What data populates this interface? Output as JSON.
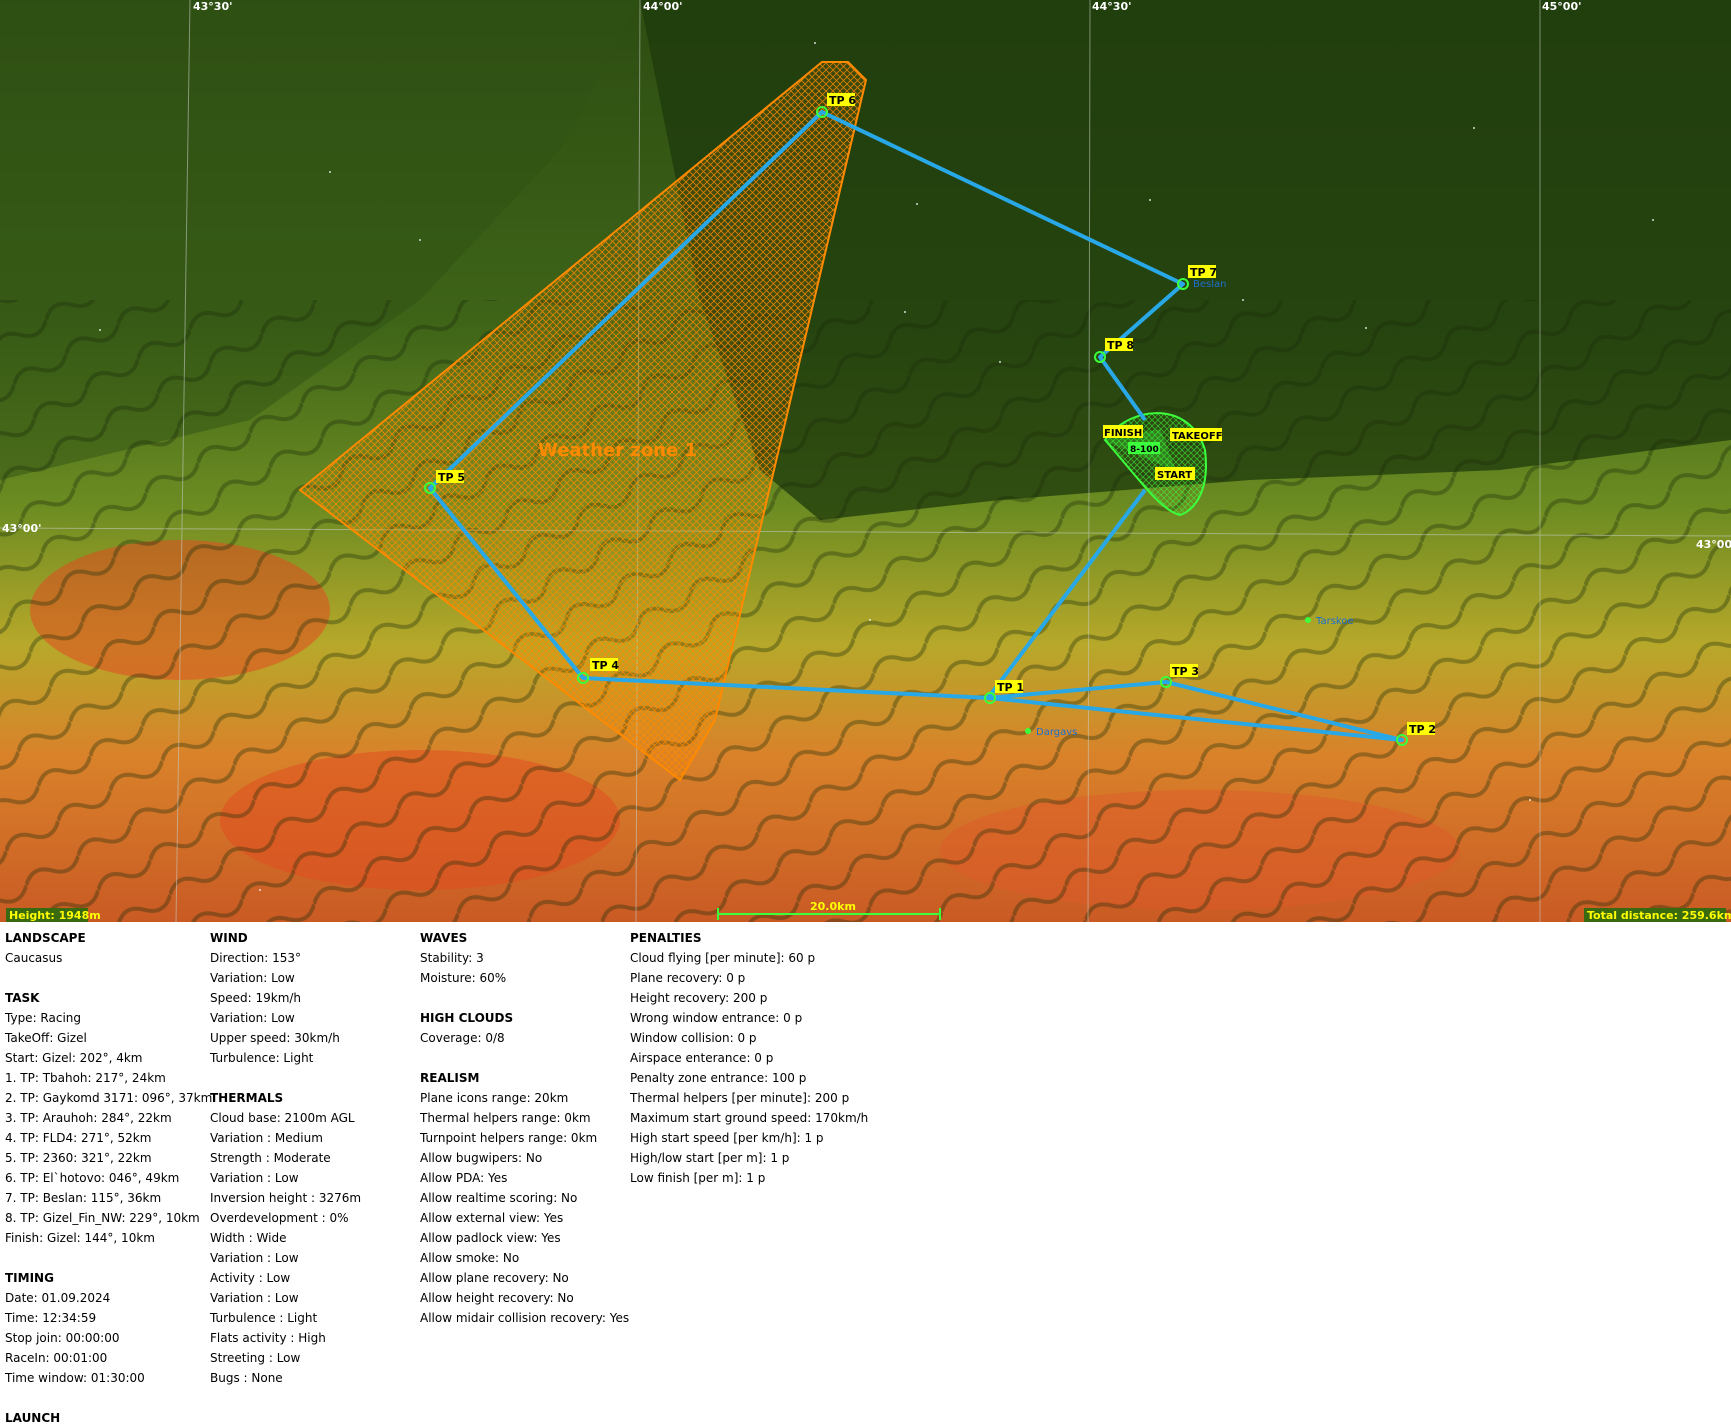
{
  "map": {
    "grid_labels": {
      "top": [
        "43°30'",
        "44°00'",
        "44°30'",
        "45°00'"
      ],
      "left": "43°00'",
      "right": "43°00'"
    },
    "zone_label": "Weather zone 1",
    "turnpoints": [
      "TP 1",
      "TP 2",
      "TP 3",
      "TP 4",
      "TP 5",
      "TP 6",
      "TP 7",
      "TP 8"
    ],
    "start_label": "START",
    "finish_label": "FINISH",
    "takeoff_label": "TAKEOFF",
    "height_label": "8-100",
    "towns": [
      "Beslan",
      "Tarskoe",
      "Dargavs"
    ],
    "height_readout": "Height: 1948m",
    "scale_label": "20.0km",
    "total_distance": "Total distance: 259.6km",
    "colors": {
      "route": "#29a8e8",
      "zone": "#ff8a00",
      "start_area": "#3cff3c",
      "label_bg": "#ffff00"
    }
  },
  "landscape": {
    "title": "LANDSCAPE",
    "value": "Caucasus"
  },
  "task": {
    "title": "TASK",
    "lines": [
      "Type: Racing",
      "TakeOff: Gizel",
      "Start: Gizel: 202°, 4km",
      "1. TP: Tbahoh: 217°, 24km",
      "2. TP: Gaykomd 3171: 096°, 37km",
      "3. TP: Arauhoh: 284°, 22km",
      "4. TP: FLD4: 271°, 52km",
      "5. TP: 2360: 321°, 22km",
      "6. TP: El`hotovo: 046°, 49km",
      "7. TP: Beslan: 115°, 36km",
      "8. TP: Gizel_Fin_NW: 229°, 10km",
      "Finish: Gizel: 144°, 10km"
    ]
  },
  "timing": {
    "title": "TIMING",
    "lines": [
      "Date: 01.09.2024",
      "Time: 12:34:59",
      "Stop join: 00:00:00",
      "RaceIn: 00:01:00",
      "Time window: 01:30:00"
    ]
  },
  "launch": {
    "title": "LAUNCH"
  },
  "wind": {
    "title": "WIND",
    "lines": [
      "Direction: 153°",
      "Variation: Low",
      "Speed: 19km/h",
      "Variation: Low",
      "Upper speed: 30km/h",
      "Turbulence: Light"
    ]
  },
  "thermals": {
    "title": "THERMALS",
    "lines": [
      "Cloud base: 2100m AGL",
      "Variation : Medium",
      "Strength : Moderate",
      "Variation : Low",
      "Inversion height : 3276m",
      "Overdevelopment : 0%",
      "Width : Wide",
      "Variation : Low",
      "Activity : Low",
      "Variation : Low",
      "Turbulence : Light",
      "Flats activity : High",
      "Streeting : Low",
      "Bugs : None"
    ]
  },
  "waves": {
    "title": "WAVES",
    "lines": [
      "Stability: 3",
      "Moisture: 60%"
    ]
  },
  "high_clouds": {
    "title": "HIGH CLOUDS",
    "lines": [
      "Coverage: 0/8"
    ]
  },
  "realism": {
    "title": "REALISM",
    "lines": [
      "Plane icons range: 20km",
      "Thermal helpers range: 0km",
      "Turnpoint helpers range: 0km",
      "Allow bugwipers: No",
      "Allow PDA: Yes",
      "Allow realtime scoring: No",
      "Allow external view: Yes",
      "Allow padlock view: Yes",
      "Allow smoke: No",
      "Allow plane recovery: No",
      "Allow height recovery: No",
      "Allow midair collision recovery: Yes"
    ]
  },
  "penalties": {
    "title": "PENALTIES",
    "lines": [
      "Cloud flying [per minute]: 60 p",
      "Plane recovery: 0 p",
      "Height recovery: 200 p",
      "Wrong window entrance: 0 p",
      "Window collision: 0 p",
      "Airspace enterance: 0 p",
      "Penalty zone entrance: 100 p",
      "Thermal helpers [per minute]: 200 p",
      "Maximum start ground speed: 170km/h",
      "High start speed [per km/h]: 1 p",
      "High/low start [per m]: 1 p",
      "Low finish [per m]: 1 p"
    ]
  }
}
